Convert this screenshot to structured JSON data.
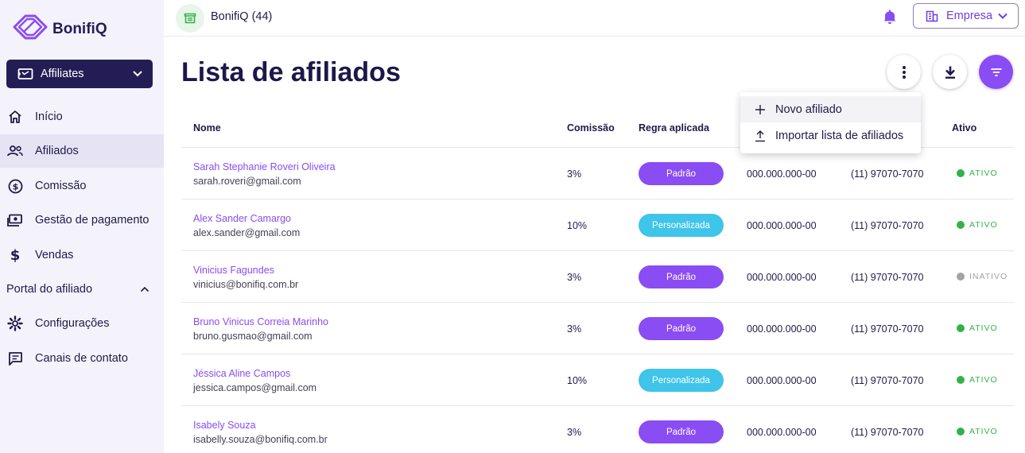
{
  "brand": {
    "name": "BonifiQ",
    "color": "#8a4cf3",
    "dark": "#241d55"
  },
  "sidebar": {
    "program_select": {
      "label": "Affiliates",
      "icon": "ticket-icon"
    },
    "items": [
      {
        "label": "Início",
        "icon": "home-icon"
      },
      {
        "label": "Afiliados",
        "icon": "people-icon",
        "active": true
      },
      {
        "label": "Comissão",
        "icon": "dollar-circle-icon"
      },
      {
        "label": "Gestão de pagamento",
        "icon": "payments-icon"
      },
      {
        "label": "Vendas",
        "icon": "dollar-icon"
      }
    ],
    "section": {
      "label": "Portal do afiliado",
      "expanded": true
    },
    "section_items": [
      {
        "label": "Configurações",
        "icon": "settings-icon"
      },
      {
        "label": "Canais de contato",
        "icon": "chat-icon"
      }
    ]
  },
  "topbar": {
    "store_name": "BonifiQ (44)",
    "company_button": "Empresa"
  },
  "page": {
    "title": "Lista de afiliados"
  },
  "menu": {
    "items": [
      {
        "label": "Novo afiliado",
        "icon": "plus-icon"
      },
      {
        "label": "Importar lista de afiliados",
        "icon": "upload-icon"
      }
    ]
  },
  "table": {
    "headers": {
      "name": "Nome",
      "commission": "Comissão",
      "rule": "Regra aplicada",
      "active": "Ativo"
    },
    "rows": [
      {
        "name": "Sarah Stephanie Roveri Oliveira",
        "email": "sarah.roveri@gmail.com",
        "commission": "3%",
        "rule": "Padrão",
        "doc": "000.000.000-00",
        "phone": "(11) 97070-7070",
        "status": "ATIVO"
      },
      {
        "name": "Alex Sander Camargo",
        "email": "alex.sander@gmail.com",
        "commission": "10%",
        "rule": "Personalizada",
        "doc": "000.000.000-00",
        "phone": "(11) 97070-7070",
        "status": "ATIVO"
      },
      {
        "name": "Vinicius Fagundes",
        "email": "vinicius@bonifiq.com.br",
        "commission": "3%",
        "rule": "Padrão",
        "doc": "000.000.000-00",
        "phone": "(11) 97070-7070",
        "status": "INATIVO"
      },
      {
        "name": "Bruno Vinicus Correia Marinho",
        "email": "bruno.gusmao@gmail.com",
        "commission": "3%",
        "rule": "Padrão",
        "doc": "000.000.000-00",
        "phone": "(11) 97070-7070",
        "status": "ATIVO"
      },
      {
        "name": "Jéssica Aline Campos",
        "email": "jessica.campos@gmail.com",
        "commission": "10%",
        "rule": "Personalizada",
        "doc": "000.000.000-00",
        "phone": "(11) 97070-7070",
        "status": "ATIVO"
      },
      {
        "name": "Isabely Souza",
        "email": "isabelly.souza@bonifiq.com.br",
        "commission": "3%",
        "rule": "Padrão",
        "doc": "000.000.000-00",
        "phone": "(11) 97070-7070",
        "status": "ATIVO"
      }
    ]
  },
  "colors": {
    "pill_default": "#8a4cf3",
    "pill_custom": "#3fc4ea",
    "status_active": "#34b24a",
    "status_inactive": "#a3a3a8"
  }
}
